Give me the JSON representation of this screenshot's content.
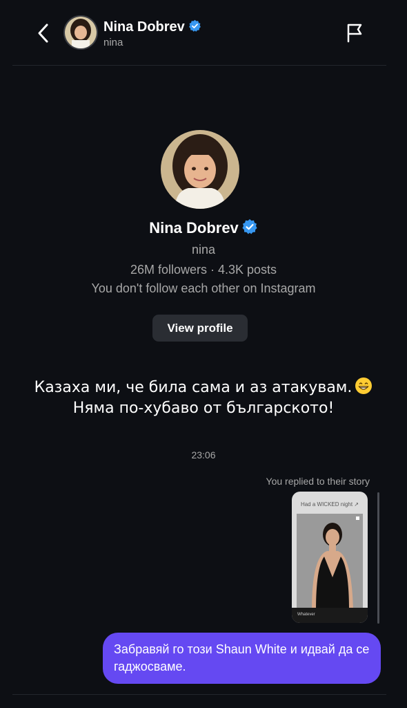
{
  "header": {
    "name": "Nina Dobrev",
    "username": "nina"
  },
  "profile": {
    "name": "Nina Dobrev",
    "username": "nina",
    "stats": "26M followers · 4.3K posts",
    "follow_status": "You don't follow each other on Instagram",
    "view_profile_label": "View profile"
  },
  "messages": {
    "incoming_line1": "Казаха ми, че била сама и аз атакувам.",
    "incoming_line2": "Няма по-хубаво от българското!",
    "timestamp": "23:06",
    "replied_label": "You replied to their story",
    "story_caption": "Had a WICKED night ↗",
    "story_bar_text": "Whatever",
    "outgoing": "Забравяй го този Shaun White и идвай да се гаджосваме."
  },
  "colors": {
    "background": "#0d0f14",
    "outgoing_bubble": "#6549f2",
    "verified": "#3797f0",
    "muted_text": "#a8a8a8"
  },
  "icons": {
    "back": "chevron-left-icon",
    "flag": "flag-icon",
    "verified": "verified-badge-icon",
    "emoji": "grinning-emoji-icon"
  }
}
